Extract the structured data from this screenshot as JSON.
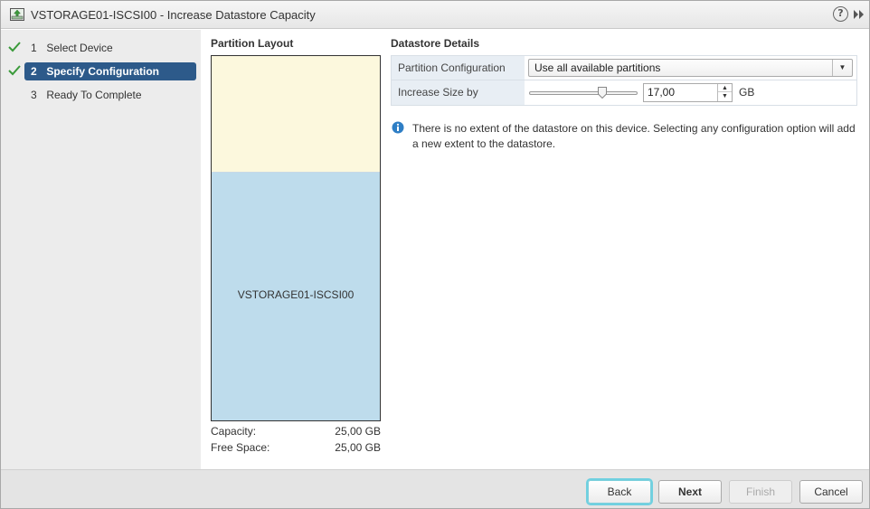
{
  "window": {
    "title": "VSTORAGE01-ISCSI00 - Increase Datastore Capacity",
    "help_glyph": "?"
  },
  "steps": [
    {
      "num": "1",
      "label": "Select Device",
      "state": "done"
    },
    {
      "num": "2",
      "label": "Specify Configuration",
      "state": "active"
    },
    {
      "num": "3",
      "label": "Ready To Complete",
      "state": "pending"
    }
  ],
  "partition_layout": {
    "title": "Partition Layout",
    "used_label": "VSTORAGE01-ISCSI00",
    "capacity_label": "Capacity:",
    "capacity_value": "25,00 GB",
    "free_label": "Free Space:",
    "free_value": "25,00 GB"
  },
  "datastore_details": {
    "title": "Datastore Details",
    "partition_config_label": "Partition Configuration",
    "partition_config_value": "Use all available partitions",
    "increase_size_label": "Increase Size by",
    "increase_size_value": "17,00",
    "increase_size_unit": "GB",
    "slider_fraction": 0.68,
    "info_text": "There is no extent of the datastore on this device. Selecting any configuration option will add a new extent to the datastore."
  },
  "footer": {
    "back": "Back",
    "next": "Next",
    "finish": "Finish",
    "cancel": "Cancel"
  },
  "colors": {
    "active_step": "#2d5a8a",
    "free_space": "#fcf8dd",
    "used_space": "#bedcec",
    "check": "#3a9a3a",
    "info": "#2e7ec5",
    "focus_ring": "#6fd0e0"
  }
}
